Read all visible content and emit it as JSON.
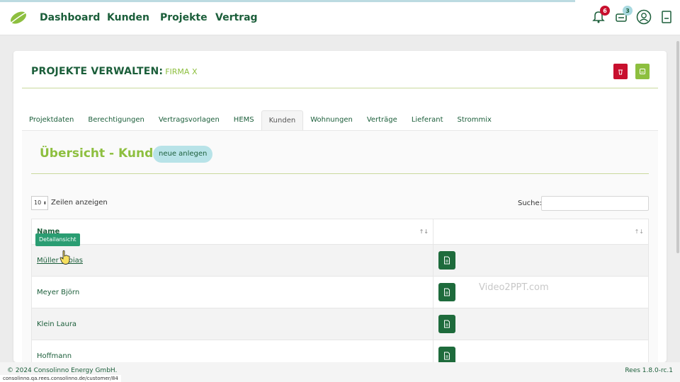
{
  "nav": {
    "items": [
      "Dashboard",
      "Kunden",
      "Projekte",
      "Vertrag"
    ],
    "notification_count": "6",
    "task_count": "3",
    "icons": [
      "bell-icon",
      "tasks-icon",
      "user-icon",
      "logout-icon"
    ]
  },
  "page": {
    "title": "PROJEKTE VERWALTEN:",
    "company": "FIRMA X"
  },
  "tabs": [
    "Projektdaten",
    "Berechtigungen",
    "Vertragsvorlagen",
    "HEMS",
    "Kunden",
    "Wohnungen",
    "Verträge",
    "Lieferant",
    "Strommix"
  ],
  "active_tab": "Kunden",
  "section": {
    "title": "Übersicht - Kunden",
    "new_button": "neue anlegen"
  },
  "table_controls": {
    "length_value": "10",
    "length_label": "Zeilen anzeigen",
    "search_label": "Suche:"
  },
  "table": {
    "header_name": "Name",
    "sort_icon": "↑↓",
    "rows": [
      {
        "name": "Müller Tobias"
      },
      {
        "name": "Meyer Björn"
      },
      {
        "name": "Klein Laura"
      },
      {
        "name": "Hoffmann"
      }
    ]
  },
  "tooltip": "Detailansicht",
  "watermark": "Video2PPT.com",
  "footer": {
    "copyright": "© 2024 Consolinno Energy GmbH.",
    "version": "Rees 1.8.0-rc.1",
    "status_url": "consolinno.qa.rees.consolinno.de/customer/84"
  },
  "colors": {
    "primary_dark": "#1b5e3a",
    "accent_green": "#8dbf3f",
    "danger": "#c8102e",
    "button_teal": "#b8e3e8"
  }
}
